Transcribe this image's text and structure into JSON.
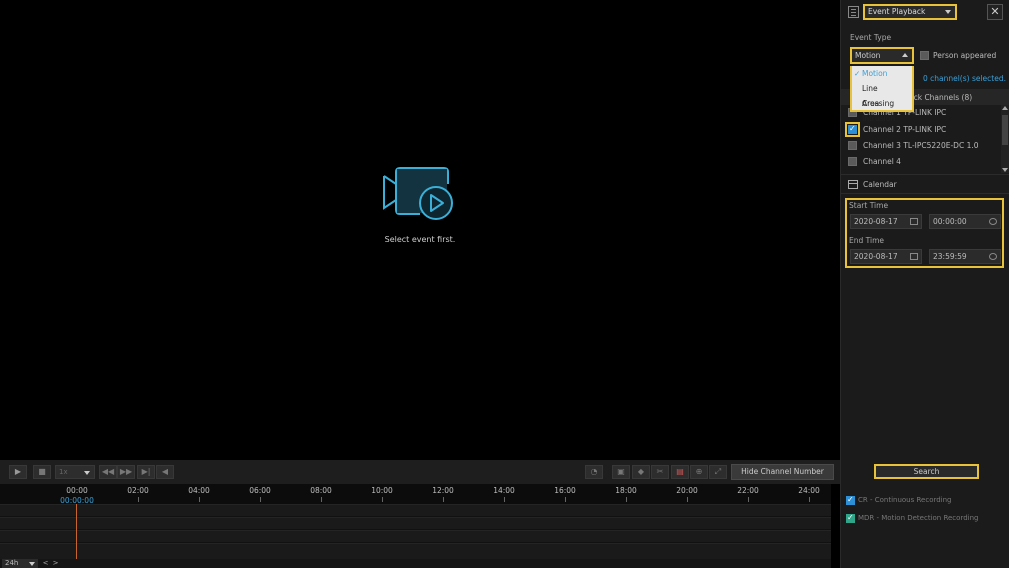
{
  "video": {
    "placeholder_text": "Select event first."
  },
  "panel": {
    "mode_select": "Event Playback",
    "close_icon": "close-icon",
    "event_type_label": "Event Type",
    "event_type_value": "Motion",
    "person_appeared": "Person appeared",
    "event_options": [
      "Motion",
      "Line Crossing",
      "Area Intrusion"
    ],
    "selected_count": "0 channel(s) selected.",
    "channels_header": "ack Channels (8)",
    "channels": [
      {
        "label": "Channel 1 TP-LINK IPC",
        "checked": false
      },
      {
        "label": "Channel 2 TP-LINK IPC",
        "checked": true
      },
      {
        "label": "Channel 3 TL-IPC5220E-DC 1.0",
        "checked": false
      },
      {
        "label": "Channel 4",
        "checked": false
      }
    ],
    "calendar_label": "Calendar",
    "start_time_label": "Start Time",
    "start_date": "2020-08-17",
    "start_time": "00:00:00",
    "end_time_label": "End Time",
    "end_date": "2020-08-17",
    "end_time": "23:59:59",
    "search_label": "Search",
    "legend": [
      {
        "label": "CR - Continuous Recording",
        "color": "#2d8fd6"
      },
      {
        "label": "MDR - Motion Detection Recording",
        "color": "#2fa58a"
      }
    ]
  },
  "toolbar": {
    "speed": "1x",
    "hide_channel_label": "Hide Channel Number"
  },
  "timeline": {
    "hours": [
      "00:00",
      "02:00",
      "04:00",
      "06:00",
      "08:00",
      "10:00",
      "12:00",
      "14:00",
      "16:00",
      "18:00",
      "20:00",
      "22:00",
      "24:00"
    ],
    "current_time": "00:00:00",
    "zoom": "24h"
  }
}
